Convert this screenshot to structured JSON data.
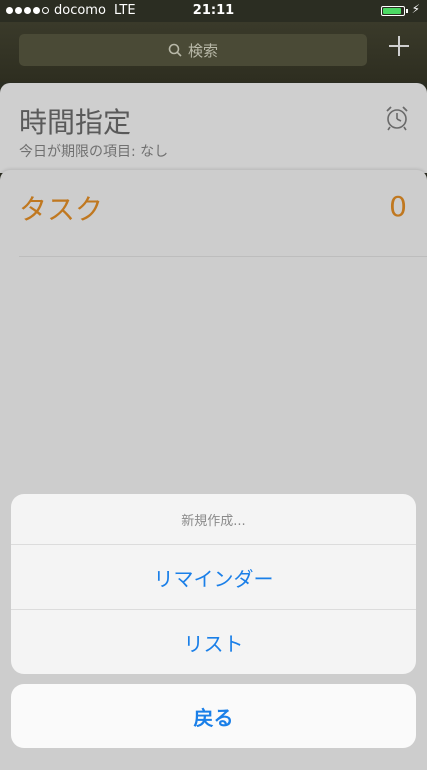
{
  "status_bar": {
    "carrier": "docomo",
    "network": "LTE",
    "time": "21:11",
    "battery_color": "#4cd964"
  },
  "header": {
    "search_placeholder": "検索",
    "add_icon": "plus-icon"
  },
  "lists": [
    {
      "title": "時間指定",
      "subtitle": "今日が期限の項目: なし",
      "icon": "alarm-clock-icon"
    },
    {
      "title": "タスク",
      "count": "0",
      "color": "#c07820"
    }
  ],
  "action_sheet": {
    "title": "新規作成...",
    "options": [
      "リマインダー",
      "リスト"
    ],
    "cancel_label": "戻る",
    "accent_color": "#1a7fe8"
  }
}
